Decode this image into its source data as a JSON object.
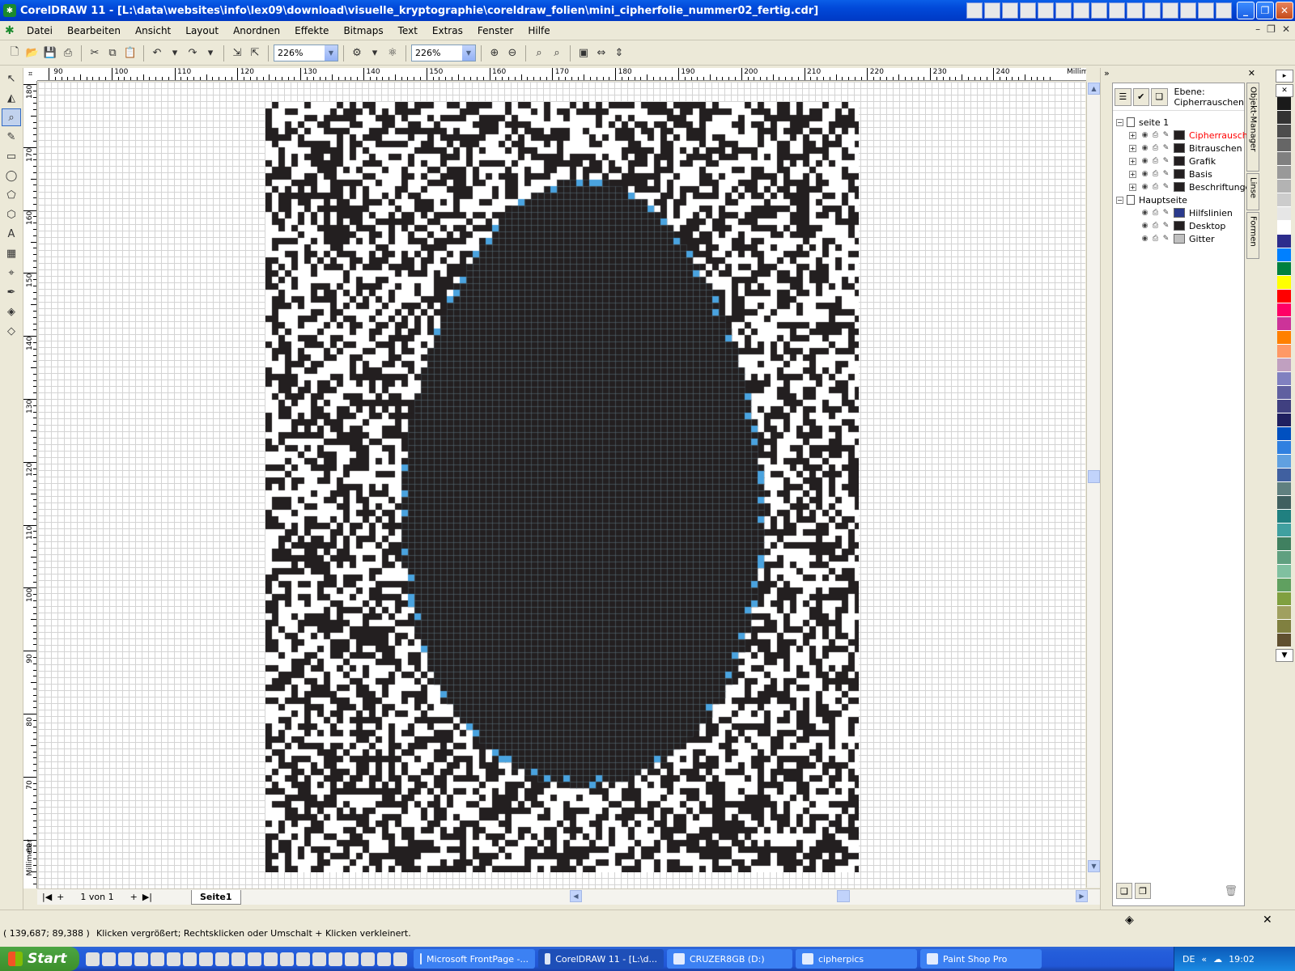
{
  "window": {
    "title": "CorelDRAW 11 - [L:\\data\\websites\\info\\lex09\\download\\visuelle_kryptographie\\coreldraw_folien\\mini_cipherfolie_nummer02_fertig.cdr]",
    "app_icon": "coreldraw-logo-icon"
  },
  "menu": {
    "items": [
      "Datei",
      "Bearbeiten",
      "Ansicht",
      "Layout",
      "Anordnen",
      "Effekte",
      "Bitmaps",
      "Text",
      "Extras",
      "Fenster",
      "Hilfe"
    ]
  },
  "toolbar": {
    "zoom1": "226%",
    "zoom2": "226%"
  },
  "rulers": {
    "unit_top": "Millimeter",
    "unit_left": "Millimeter",
    "h_labels": [
      "90",
      "100",
      "110",
      "120",
      "130",
      "140",
      "150",
      "160",
      "170",
      "180",
      "190",
      "200",
      "210",
      "220",
      "230",
      "240"
    ],
    "v_labels": [
      "180",
      "170",
      "160",
      "150",
      "140",
      "130",
      "120",
      "110",
      "100",
      "90",
      "80",
      "70",
      "60"
    ]
  },
  "pages": {
    "count_label": "1 von 1",
    "tab_label": "Seite1"
  },
  "object_manager": {
    "ebene_label": "Ebene:",
    "ebene_value": "Cipherrauschen",
    "page1": "seite 1",
    "page1_layers": [
      {
        "name": "Cipherrausch",
        "active": true,
        "color": "#231f20"
      },
      {
        "name": "Bitrauschen",
        "active": false,
        "color": "#231f20"
      },
      {
        "name": "Grafik",
        "active": false,
        "color": "#231f20"
      },
      {
        "name": "Basis",
        "active": false,
        "color": "#231f20"
      },
      {
        "name": "Beschriftunge",
        "active": false,
        "color": "#231f20"
      }
    ],
    "master": "Hauptseite",
    "master_layers": [
      {
        "name": "Hilfslinien",
        "color": "#2b3a8c"
      },
      {
        "name": "Desktop",
        "color": "#231f20"
      },
      {
        "name": "Gitter",
        "color": "#c0c0c0"
      }
    ],
    "tabs": [
      "Objekt-Manager",
      "Linse",
      "Formen"
    ]
  },
  "palette": [
    "#1a1a1a",
    "#333333",
    "#4d4d4d",
    "#666666",
    "#808080",
    "#999999",
    "#b3b3b3",
    "#cccccc",
    "#e6e6e6",
    "#ffffff",
    "#2d2d8c",
    "#0080ff",
    "#008040",
    "#ffff00",
    "#ff0000",
    "#ff0066",
    "#cc3399",
    "#ff8000",
    "#ff9966",
    "#c0a0c0",
    "#8080c0",
    "#6060a0",
    "#404080",
    "#202060",
    "#0050c0",
    "#3080e0",
    "#60a0e0",
    "#4060a0",
    "#608080",
    "#406060",
    "#208080",
    "#40a0a0",
    "#408060",
    "#60a080",
    "#80c0a0",
    "#60a060",
    "#80a040",
    "#a0a060",
    "#808040",
    "#605030"
  ],
  "status": {
    "coords": "( 139,687; 89,388 )",
    "message": "Klicken vergrößert; Rechtsklicken oder Umschalt + Klicken verkleinert."
  },
  "taskbar": {
    "start": "Start",
    "tasks": [
      "Microsoft FrontPage -...",
      "CorelDRAW 11 - [L:\\d...",
      "CRUZER8GB (D:)",
      "cipherpics",
      "Paint Shop Pro"
    ],
    "lang": "DE",
    "clock": "19:02"
  },
  "colors": {
    "pattern_dark": "#231f20",
    "accent_blue": "#4aa3df",
    "active_layer": "#ff0000"
  }
}
